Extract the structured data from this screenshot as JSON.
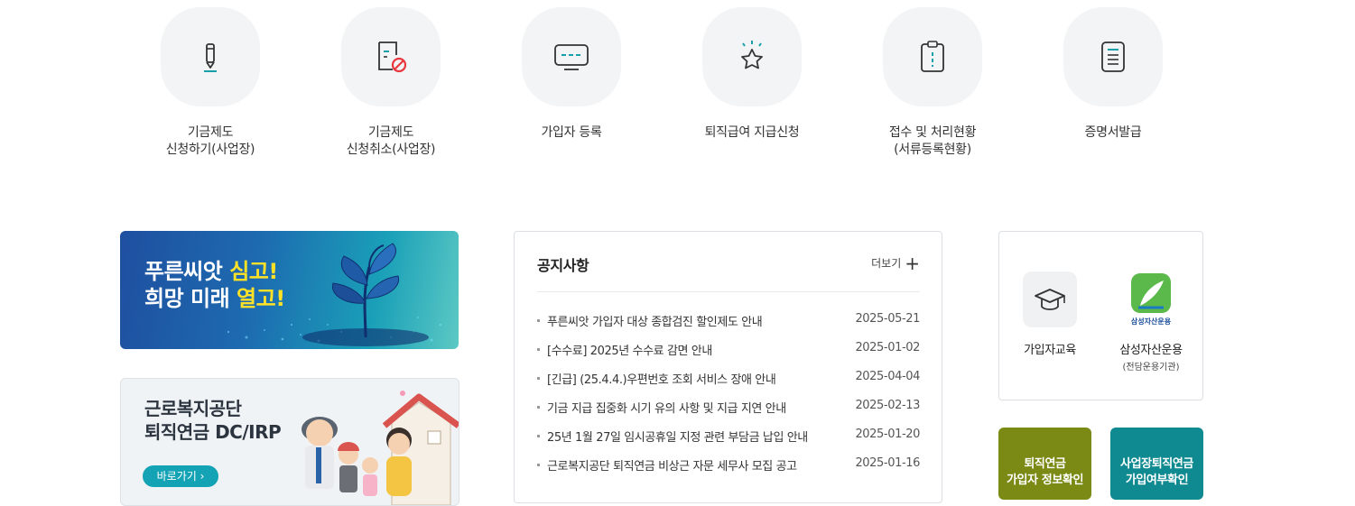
{
  "quick_menu": [
    {
      "label": "기금제도\n신청하기(사업장)",
      "icon": "pencil-icon"
    },
    {
      "label": "기금제도\n신청취소(사업장)",
      "icon": "document-cancel-icon"
    },
    {
      "label": "가입자 등록",
      "icon": "monitor-icon"
    },
    {
      "label": "퇴직급여 지급신청",
      "icon": "star-icon"
    },
    {
      "label": "접수 및 처리현황\n(서류등록현황)",
      "icon": "clipboard-icon"
    },
    {
      "label": "증명서발급",
      "icon": "certificate-icon"
    }
  ],
  "banner1": {
    "line1_a": "푸른씨앗 ",
    "line1_b": "심고!",
    "line2_a": "희망 미래 ",
    "line2_b": "열고!"
  },
  "banner2": {
    "line1": "근로복지공단",
    "line2": "퇴직연금 DC/IRP",
    "button": "바로가기 ›"
  },
  "notice": {
    "title": "공지사항",
    "more": "더보기",
    "items": [
      {
        "title": "푸른씨앗 가입자 대상 종합검진 할인제도 안내",
        "date": "2025-05-21"
      },
      {
        "title": "[수수료] 2025년 수수료 감면 안내",
        "date": "2025-01-02"
      },
      {
        "title": "[긴급] (25.4.4.)우편번호 조회 서비스 장애 안내",
        "date": "2025-04-04"
      },
      {
        "title": "기금 지급 집중화 시기 유의 사항 및 지급 지연 안내",
        "date": "2025-02-13"
      },
      {
        "title": "25년 1월 27일 임시공휴일 지정 관련 부담금 납입 안내",
        "date": "2025-01-20"
      },
      {
        "title": "근로복지공단 퇴직연금 비상근 자문 세무사 모집 공고",
        "date": "2025-01-16"
      }
    ]
  },
  "right_box": {
    "education": {
      "label": "가입자교육",
      "icon": "graduation-cap-icon"
    },
    "samsung": {
      "label": "삼성자산운용",
      "sub": "(전담운용기관)",
      "logo_text": "삼성자산운용",
      "icon": "samsung-logo-icon"
    }
  },
  "green_buttons": [
    {
      "label": "퇴직연금\n가입자 정보확인",
      "color": "#7a8a14"
    },
    {
      "label": "사업장퇴직연금\n가입여부확인",
      "color": "#0f8a91"
    }
  ]
}
